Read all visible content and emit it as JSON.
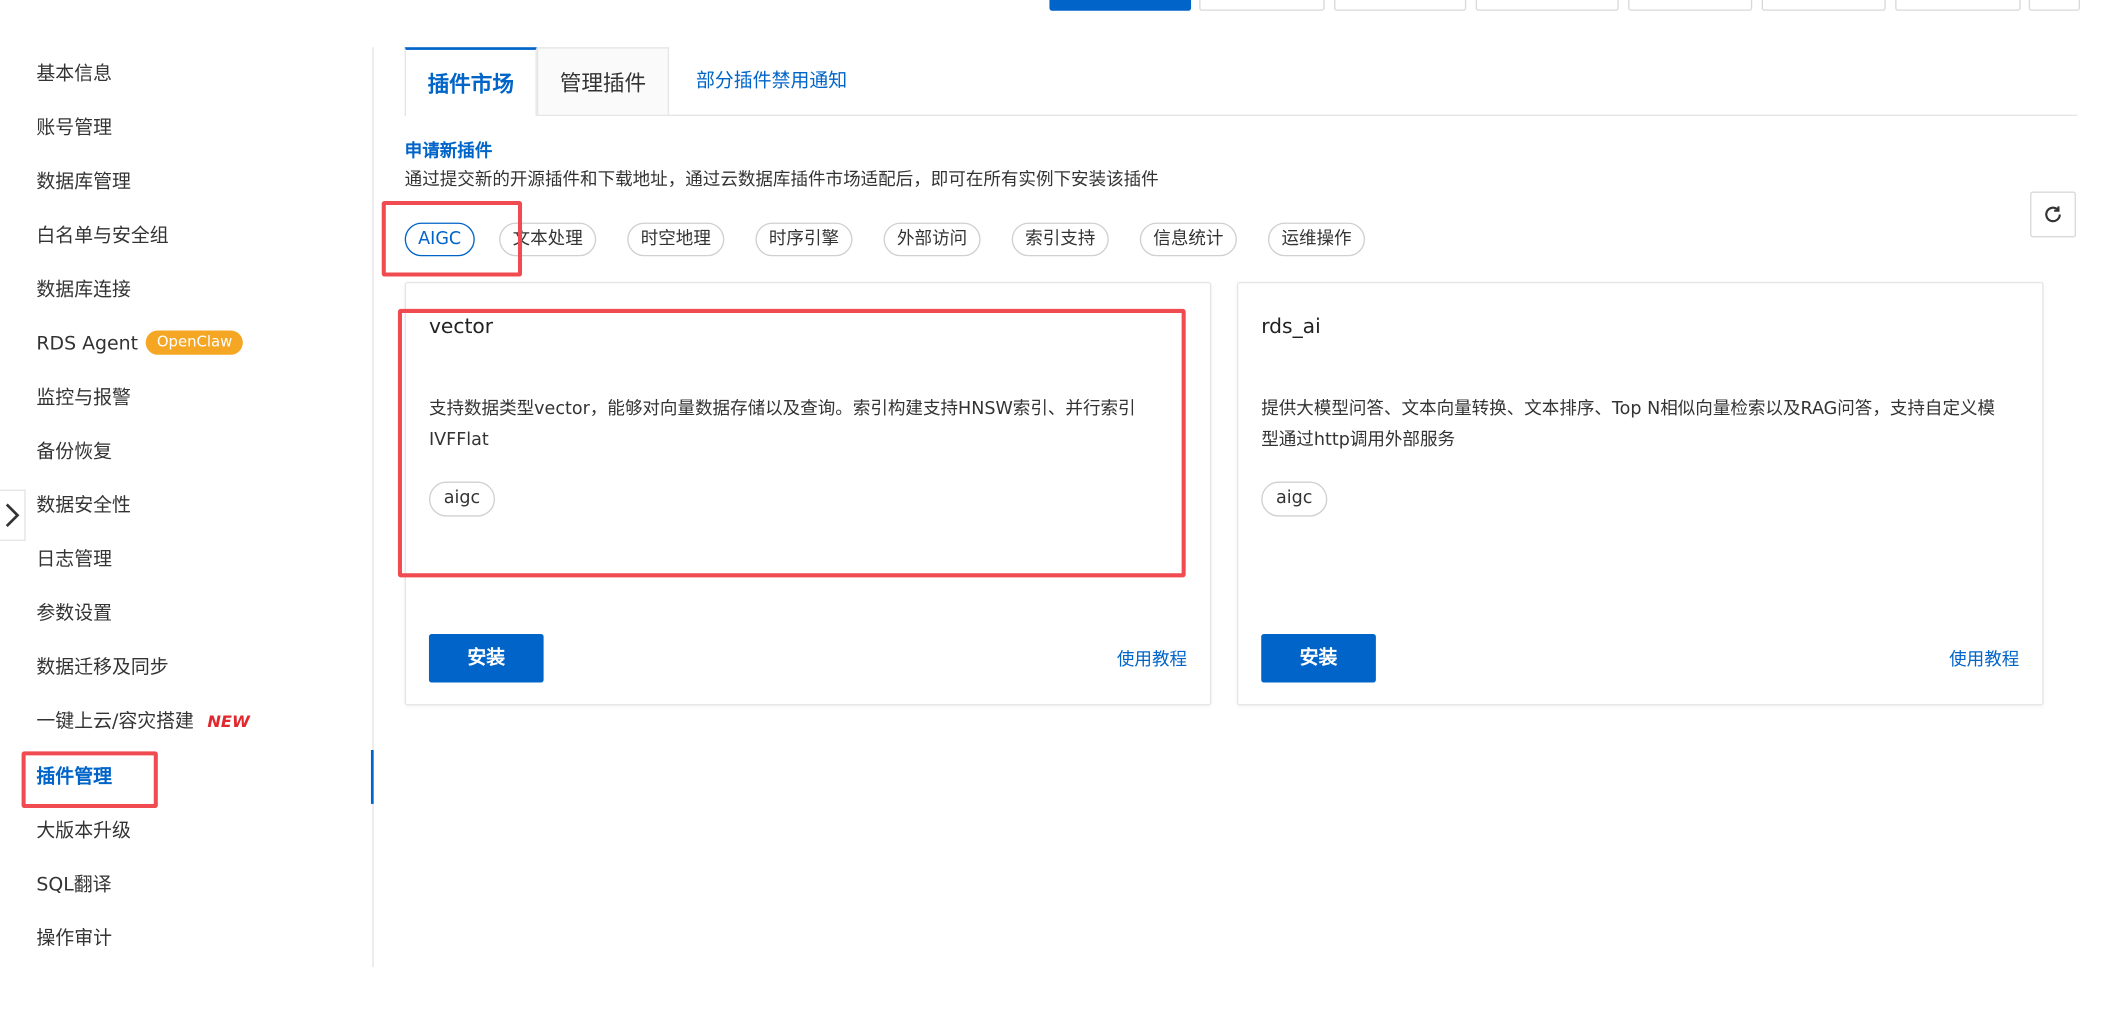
{
  "sidebar": {
    "items": [
      {
        "label": "基本信息"
      },
      {
        "label": "账号管理"
      },
      {
        "label": "数据库管理"
      },
      {
        "label": "白名单与安全组"
      },
      {
        "label": "数据库连接"
      },
      {
        "label": "RDS Agent",
        "badge": "OpenClaw"
      },
      {
        "label": "监控与报警"
      },
      {
        "label": "备份恢复"
      },
      {
        "label": "数据安全性"
      },
      {
        "label": "日志管理"
      },
      {
        "label": "参数设置"
      },
      {
        "label": "数据迁移及同步"
      },
      {
        "label": "一键上云/容灾搭建",
        "badge": "NEW"
      },
      {
        "label": "插件管理",
        "active": true
      },
      {
        "label": "大版本升级"
      },
      {
        "label": "SQL翻译"
      },
      {
        "label": "操作审计"
      }
    ]
  },
  "tabs": {
    "market": "插件市场",
    "manage": "管理插件",
    "notice_link": "部分插件禁用通知"
  },
  "apply": {
    "title": "申请新插件",
    "description": "通过提交新的开源插件和下载地址，通过云数据库插件市场适配后，即可在所有实例下安装该插件"
  },
  "categories": [
    "AIGC",
    "文本处理",
    "时空地理",
    "时序引擎",
    "外部访问",
    "索引支持",
    "信息统计",
    "运维操作"
  ],
  "active_category": "AIGC",
  "plugins": [
    {
      "name": "vector",
      "description": "支持数据类型vector，能够对向量数据存储以及查询。索引构建支持HNSW索引、并行索引IVFFlat",
      "tag": "aigc",
      "install_label": "安装",
      "tutorial_label": "使用教程"
    },
    {
      "name": "rds_ai",
      "description": "提供大模型问答、文本向量转换、文本排序、Top N相似向量检索以及RAG问答，支持自定义模型通过http调用外部服务",
      "tag": "aigc",
      "install_label": "安装",
      "tutorial_label": "使用教程"
    }
  ],
  "colors": {
    "primary": "#0064c8",
    "annotation": "#ef4b50",
    "openclaw_badge": "#f5a623",
    "new_badge": "#e0282e"
  },
  "icons": {
    "refresh": "refresh-icon",
    "collapse": "chevron-right-icon"
  }
}
